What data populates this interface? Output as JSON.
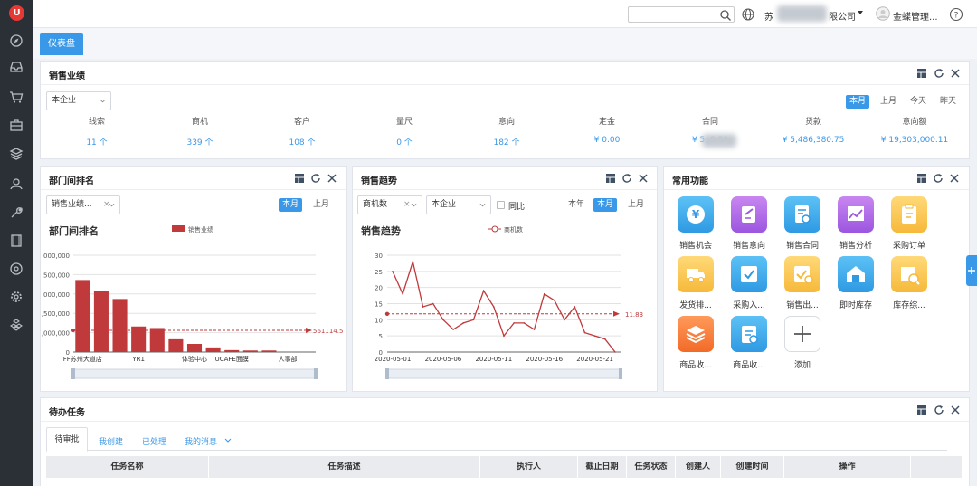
{
  "app": {
    "logo_text": "U"
  },
  "header": {
    "company_prefix": "苏",
    "company_suffix": "限公司",
    "user_name": "金蝶管理...",
    "help_label": "?"
  },
  "tabs": [
    {
      "label": "仪表盘"
    }
  ],
  "sales": {
    "title": "销售业绩",
    "scope_select": "本企业",
    "periods": [
      "本月",
      "上月",
      "今天",
      "昨天"
    ],
    "stats": [
      {
        "label": "线索",
        "value": "11 个"
      },
      {
        "label": "商机",
        "value": "339 个"
      },
      {
        "label": "客户",
        "value": "108 个"
      },
      {
        "label": "量尺",
        "value": "0 个"
      },
      {
        "label": "意向",
        "value": "182 个"
      },
      {
        "label": "定金",
        "value": "¥ 0.00"
      },
      {
        "label": "合同",
        "value": "¥ 5,      9.90"
      },
      {
        "label": "货款",
        "value": "¥ 5,486,380.75"
      },
      {
        "label": "意向额",
        "value": "¥ 19,303,000.11"
      }
    ]
  },
  "dept": {
    "title": "部门间排名",
    "metric_select": "销售业绩...",
    "periods": [
      "本月",
      "上月"
    ],
    "chart_title": "部门间排名",
    "legend": "销售业绩",
    "avg_label": "561114.5"
  },
  "trend": {
    "title": "销售趋势",
    "metric_select": "商机数",
    "scope_select": "本企业",
    "yoy_label": "同比",
    "periods": [
      "本年",
      "本月",
      "上月"
    ],
    "chart_title": "销售趋势",
    "legend": "商机数",
    "avg_label": "11.83"
  },
  "functions": {
    "title": "常用功能",
    "items": [
      {
        "label": "销售机会",
        "icon": "yen-icon"
      },
      {
        "label": "销售意向",
        "icon": "edit-icon"
      },
      {
        "label": "销售合同",
        "icon": "contract-icon"
      },
      {
        "label": "销售分析",
        "icon": "analysis-icon"
      },
      {
        "label": "采购订单",
        "icon": "clipboard-icon"
      },
      {
        "label": "发货排...",
        "icon": "truck-icon"
      },
      {
        "label": "采购入...",
        "icon": "check-icon"
      },
      {
        "label": "销售出...",
        "icon": "outbound-icon"
      },
      {
        "label": "即时库存",
        "icon": "warehouse-icon"
      },
      {
        "label": "库存综...",
        "icon": "inventory-icon"
      },
      {
        "label": "商品收...",
        "icon": "layers-icon"
      },
      {
        "label": "商品收...",
        "icon": "receipt-icon"
      },
      {
        "label": "添加",
        "icon": "plus-icon"
      }
    ]
  },
  "tasks": {
    "title": "待办任务",
    "tabs": [
      "待审批",
      "我创建",
      "已处理",
      "我的消息"
    ],
    "columns": [
      "任务名称",
      "任务描述",
      "执行人",
      "截止日期",
      "任务状态",
      "创建人",
      "创建时间",
      "操作"
    ]
  },
  "colors": {
    "accent": "#3a98e8",
    "bar": "#c0393b",
    "line": "#c0393b",
    "sidebar": "#2b2f36"
  },
  "chart_data": [
    {
      "type": "bar",
      "title": "部门间排名",
      "series": [
        {
          "name": "销售业绩",
          "values": [
            1860000,
            1580000,
            1370000,
            660000,
            620000,
            330000,
            210000,
            120000,
            50000,
            40000,
            40000,
            10000,
            5000
          ]
        }
      ],
      "categories": [
        "FF苏州大道店",
        "",
        "",
        "YR1",
        "",
        "",
        "体验中心",
        "",
        "UCAFE面膜",
        "",
        "",
        "人事部",
        ""
      ],
      "x_tick_labels": [
        "FF苏州大道店",
        "YR1",
        "体验中心",
        "UCAFE面膜",
        "人事部"
      ],
      "y_tick_labels": [
        "0",
        ",000,000",
        ",500,000",
        "000,000",
        "500,000",
        "000,000"
      ],
      "ylim": [
        0,
        2500000
      ],
      "y_ticks": [
        0,
        500000,
        1000000,
        1500000,
        2000000,
        2500000
      ],
      "average": 561114.5
    },
    {
      "type": "line",
      "title": "销售趋势",
      "series": [
        {
          "name": "商机数",
          "values": [
            25,
            18,
            28,
            14,
            15,
            10,
            7,
            9,
            10,
            19,
            14,
            5,
            9,
            9,
            7,
            18,
            16,
            10,
            14,
            6,
            5,
            4,
            0
          ]
        }
      ],
      "x": [
        "2020-05-01",
        "2020-05-02",
        "2020-05-03",
        "2020-05-04",
        "2020-05-05",
        "2020-05-06",
        "2020-05-07",
        "2020-05-08",
        "2020-05-09",
        "2020-05-10",
        "2020-05-11",
        "2020-05-12",
        "2020-05-13",
        "2020-05-14",
        "2020-05-15",
        "2020-05-16",
        "2020-05-17",
        "2020-05-18",
        "2020-05-19",
        "2020-05-20",
        "2020-05-21",
        "2020-05-22",
        "2020-05-23"
      ],
      "x_tick_labels": [
        "2020-05-01",
        "2020-05-06",
        "2020-05-11",
        "2020-05-16",
        "2020-05-21"
      ],
      "ylim": [
        0,
        30
      ],
      "y_ticks": [
        0,
        5,
        10,
        15,
        20,
        25,
        30
      ],
      "average": 11.83
    }
  ]
}
